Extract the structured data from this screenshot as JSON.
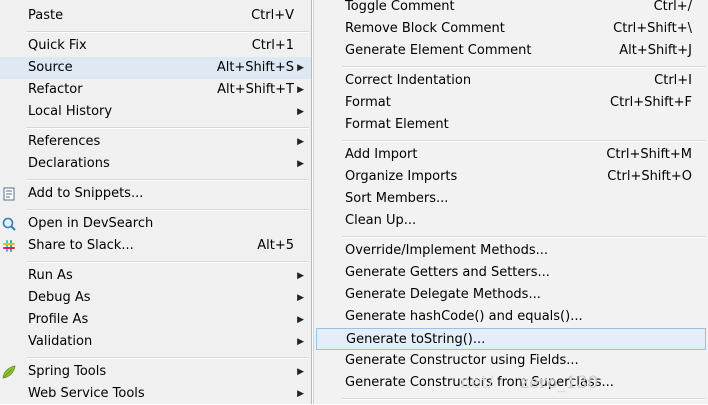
{
  "left_menu": {
    "items": [
      {
        "label": "Paste",
        "accel": "Ctrl+V"
      },
      {
        "label": "Quick Fix",
        "accel": "Ctrl+1"
      },
      {
        "label": "Source",
        "accel": "Alt+Shift+S"
      },
      {
        "label": "Refactor",
        "accel": "Alt+Shift+T"
      },
      {
        "label": "Local History"
      },
      {
        "label": "References"
      },
      {
        "label": "Declarations"
      },
      {
        "label": "Add to Snippets..."
      },
      {
        "label": "Open in DevSearch"
      },
      {
        "label": "Share to Slack...",
        "accel": "Alt+5"
      },
      {
        "label": "Run As"
      },
      {
        "label": "Debug As"
      },
      {
        "label": "Profile As"
      },
      {
        "label": "Validation"
      },
      {
        "label": "Spring Tools"
      },
      {
        "label": "Web Service Tools"
      }
    ]
  },
  "right_menu": {
    "items": [
      {
        "label": "Toggle Comment",
        "accel": "Ctrl+/"
      },
      {
        "label": "Remove Block Comment",
        "accel": "Ctrl+Shift+\\"
      },
      {
        "label": "Generate Element Comment",
        "accel": "Alt+Shift+J"
      },
      {
        "label": "Correct Indentation",
        "accel": "Ctrl+I"
      },
      {
        "label": "Format",
        "accel": "Ctrl+Shift+F"
      },
      {
        "label": "Format Element"
      },
      {
        "label": "Add Import",
        "accel": "Ctrl+Shift+M"
      },
      {
        "label": "Organize Imports",
        "accel": "Ctrl+Shift+O"
      },
      {
        "label": "Sort Members..."
      },
      {
        "label": "Clean Up..."
      },
      {
        "label": "Override/Implement Methods..."
      },
      {
        "label": "Generate Getters and Setters..."
      },
      {
        "label": "Generate Delegate Methods..."
      },
      {
        "label": "Generate hashCode() and equals()..."
      },
      {
        "label": "Generate toString()..."
      },
      {
        "label": "Generate Constructor using Fields..."
      },
      {
        "label": "Generate Constructors from Superclass..."
      }
    ]
  },
  "watermark": {
    "left": "net/",
    "right": "zero_130"
  }
}
